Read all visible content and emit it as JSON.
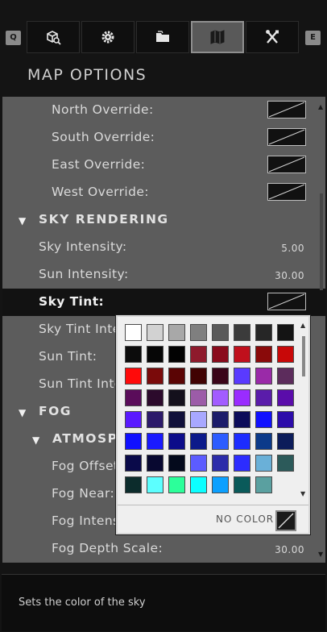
{
  "topbar": {
    "left_hotkey": "Q",
    "right_hotkey": "E",
    "tabs": [
      {
        "icon": "search-cube-icon"
      },
      {
        "icon": "gear-icon"
      },
      {
        "icon": "folder-icon"
      },
      {
        "icon": "map-icon",
        "active": true
      },
      {
        "icon": "tools-icon"
      }
    ]
  },
  "panel": {
    "title": "MAP OPTIONS"
  },
  "list": [
    {
      "label": "North Override:",
      "indent": 2,
      "control": "swatch"
    },
    {
      "label": "South Override:",
      "indent": 2,
      "control": "swatch"
    },
    {
      "label": "East Override:",
      "indent": 2,
      "control": "swatch"
    },
    {
      "label": "West Override:",
      "indent": 2,
      "control": "swatch"
    },
    {
      "label": "SKY RENDERING",
      "indent": 0,
      "section": true
    },
    {
      "label": "Sky Intensity:",
      "indent": 1,
      "value": "5.00"
    },
    {
      "label": "Sun Intensity:",
      "indent": 1,
      "value": "30.00"
    },
    {
      "label": "Sky Tint:",
      "indent": 1,
      "control": "swatch",
      "selected": true
    },
    {
      "label": "Sky Tint Intensity:",
      "indent": 1
    },
    {
      "label": "Sun Tint:",
      "indent": 1
    },
    {
      "label": "Sun Tint Intensity:",
      "indent": 1
    },
    {
      "label": "FOG",
      "indent": 0,
      "section": true
    },
    {
      "label": "ATMOSPHERIC",
      "indent": 1,
      "section": true
    },
    {
      "label": "Fog Offset:",
      "indent": 2
    },
    {
      "label": "Fog Near:",
      "indent": 2
    },
    {
      "label": "Fog Intensity:",
      "indent": 2
    },
    {
      "label": "Fog Depth Scale:",
      "indent": 2,
      "value": "30.00"
    }
  ],
  "footer": {
    "description": "Sets the color of the sky"
  },
  "picker": {
    "no_color_label": "NO COLOR",
    "colors": [
      "#ffffff",
      "#d2d2d2",
      "#a8a8a8",
      "#7f7f7f",
      "#5a5a5a",
      "#3b3b3b",
      "#262626",
      "#141414",
      "#0c0c0c",
      "#060606",
      "#020202",
      "#8e1a2c",
      "#8a0b1c",
      "#c0101c",
      "#8a0a0a",
      "#c80808",
      "#ff0a0a",
      "#7a0a0a",
      "#5a0404",
      "#400202",
      "#3a0418",
      "#5a3aff",
      "#9a2aa8",
      "#5c2c5c",
      "#5a0c5a",
      "#2c0a2c",
      "#14101c",
      "#9c5ca8",
      "#a25cff",
      "#9a2cff",
      "#5a1caa",
      "#5a0caa",
      "#5a1aff",
      "#2c1a6a",
      "#10103a",
      "#a8a8ff",
      "#1c1c6a",
      "#0c0c5a",
      "#1010ff",
      "#2c0caa",
      "#1010ff",
      "#1a1aff",
      "#0c0c8a",
      "#0c1a8a",
      "#2c5cff",
      "#1c2cff",
      "#0c3a8a",
      "#0c1c5a",
      "#0a0a4a",
      "#080830",
      "#040a1c",
      "#5c5cff",
      "#2c2caa",
      "#2c2cff",
      "#6ab0d8",
      "#2c5a5a",
      "#0c2c2c",
      "#5cffff",
      "#2cff9a",
      "#0cffff",
      "#0ca0ff",
      "#0a5a5a",
      "#5aa0a0"
    ]
  }
}
